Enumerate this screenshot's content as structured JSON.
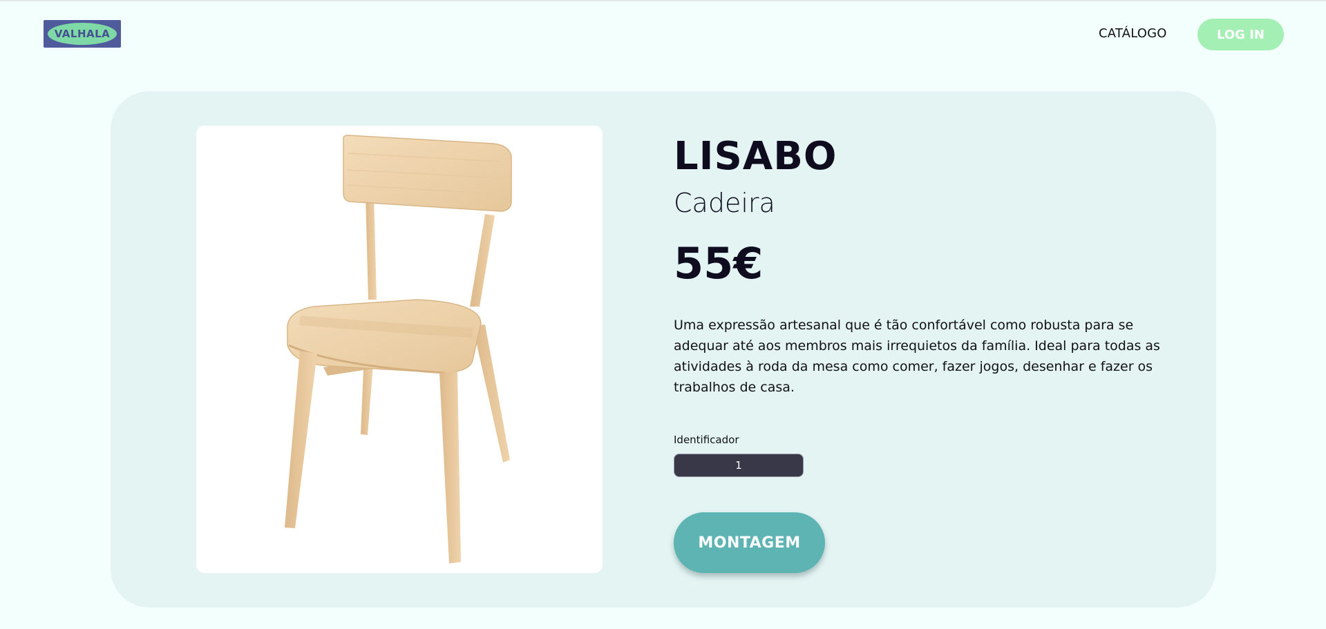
{
  "header": {
    "logo_text": "VALHALA",
    "nav": [
      {
        "label": "CATÁLOGO"
      }
    ],
    "login_label": "LOG IN"
  },
  "product": {
    "name": "LISABO",
    "type": "Cadeira",
    "price": "55€",
    "description": "Uma expressão artesanal que é tão confortável como robusta para se adequar até aos membros mais irrequietos da família. Ideal para todas as atividades à roda da mesa como comer, fazer jogos, desenhar e fazer os trabalhos de casa.",
    "identifier_label": "Identificador",
    "identifier_value": "1",
    "assembly_label": "MONTAGEM"
  },
  "colors": {
    "page_background": "#f3fffd",
    "card_background": "#e3f4f3",
    "login_button": "#a4f0b4",
    "assembly_button": "#5db4b3",
    "identifier_field": "#393849",
    "logo_background": "#4f5b9b",
    "logo_oval": "#7fd9a7",
    "chair_wood": "#f0d7b1"
  },
  "icons": {
    "logo": "valhala-logo",
    "product_image": "wooden-chair-image"
  }
}
